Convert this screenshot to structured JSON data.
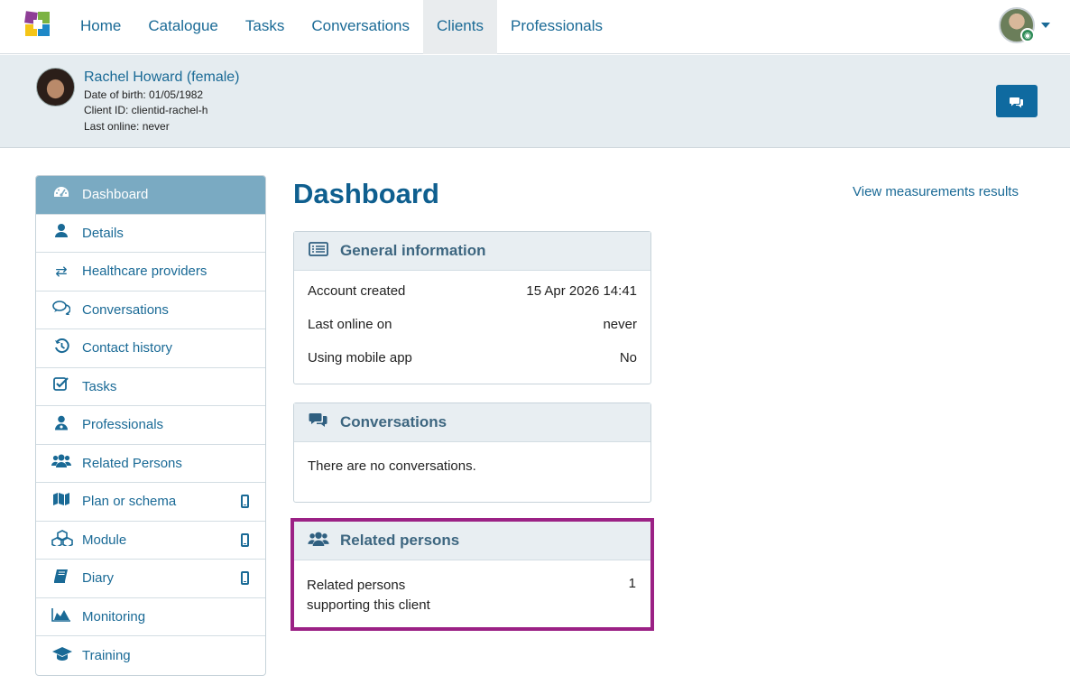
{
  "nav": {
    "items": [
      "Home",
      "Catalogue",
      "Tasks",
      "Conversations",
      "Clients",
      "Professionals"
    ],
    "active": "Clients"
  },
  "client": {
    "name": "Rachel Howard (female)",
    "dob": "Date of birth: 01/05/1982",
    "client_id": "Client ID: clientid-rachel-h",
    "last_online": "Last online: never"
  },
  "sidebar": {
    "items": [
      {
        "label": "Dashboard",
        "icon": "dashboard-icon"
      },
      {
        "label": "Details",
        "icon": "user-icon"
      },
      {
        "label": "Healthcare providers",
        "icon": "exchange-icon"
      },
      {
        "label": "Conversations",
        "icon": "chat-icon"
      },
      {
        "label": "Contact history",
        "icon": "history-icon"
      },
      {
        "label": "Tasks",
        "icon": "checkbox-icon"
      },
      {
        "label": "Professionals",
        "icon": "doctor-icon"
      },
      {
        "label": "Related Persons",
        "icon": "users-icon"
      },
      {
        "label": "Plan or schema",
        "icon": "map-icon"
      },
      {
        "label": "Module",
        "icon": "cubes-icon"
      },
      {
        "label": "Diary",
        "icon": "book-icon"
      },
      {
        "label": "Monitoring",
        "icon": "area-chart-icon"
      },
      {
        "label": "Training",
        "icon": "graduation-cap-icon"
      }
    ]
  },
  "main": {
    "title": "Dashboard",
    "view_link": "View measurements results",
    "general": {
      "title": "General information",
      "rows": [
        {
          "label": "Account created",
          "value": "15 Apr 2026 14:41"
        },
        {
          "label": "Last online on",
          "value": "never"
        },
        {
          "label": "Using mobile app",
          "value": "No"
        }
      ]
    },
    "conversations": {
      "title": "Conversations",
      "empty": "There are no conversations."
    },
    "related": {
      "title": "Related persons",
      "label_line1": "Related persons",
      "label_line2": "supporting this client",
      "value": "1"
    }
  },
  "colors": {
    "accent": "#1a6a96",
    "highlight": "#9b2185",
    "sidebar_active": "#7aaac2"
  }
}
